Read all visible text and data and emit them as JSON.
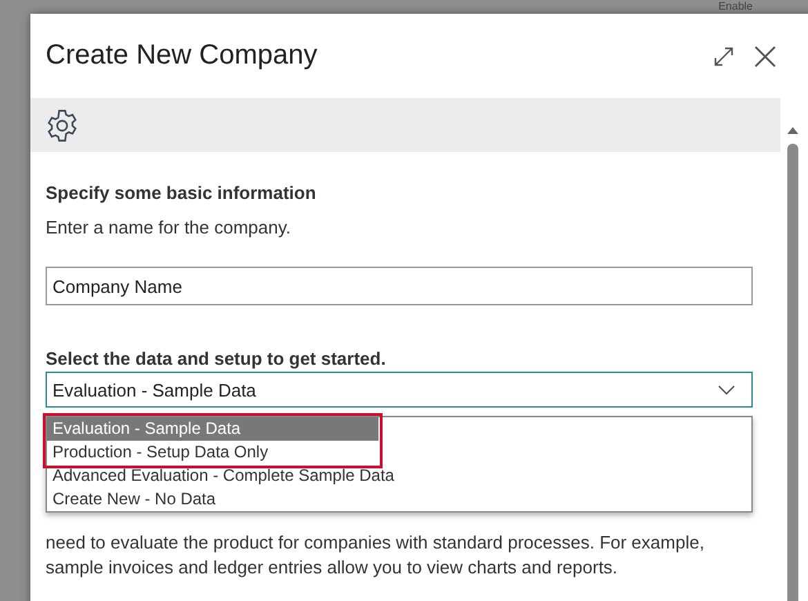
{
  "backdrop": {
    "text": "Enable"
  },
  "dialog": {
    "title": "Create New Company"
  },
  "section": {
    "heading": "Specify some basic information",
    "instruction": "Enter a name for the company."
  },
  "name_field": {
    "value": "Company Name"
  },
  "data_select": {
    "label": "Select the data and setup to get started.",
    "value": "Evaluation - Sample Data",
    "expanded": true,
    "options": [
      {
        "label": "Evaluation - Sample Data",
        "selected": true,
        "highlighted": true
      },
      {
        "label": "Production - Setup Data Only",
        "selected": false,
        "highlighted": true
      },
      {
        "label": "Advanced Evaluation - Complete Sample Data",
        "selected": false,
        "highlighted": false
      },
      {
        "label": "Create New - No Data",
        "selected": false,
        "highlighted": false
      }
    ]
  },
  "description": {
    "lines": [
      "need to evaluate the product for companies with standard processes. For example,",
      "sample invoices and ledger entries allow you to view charts and reports."
    ]
  }
}
